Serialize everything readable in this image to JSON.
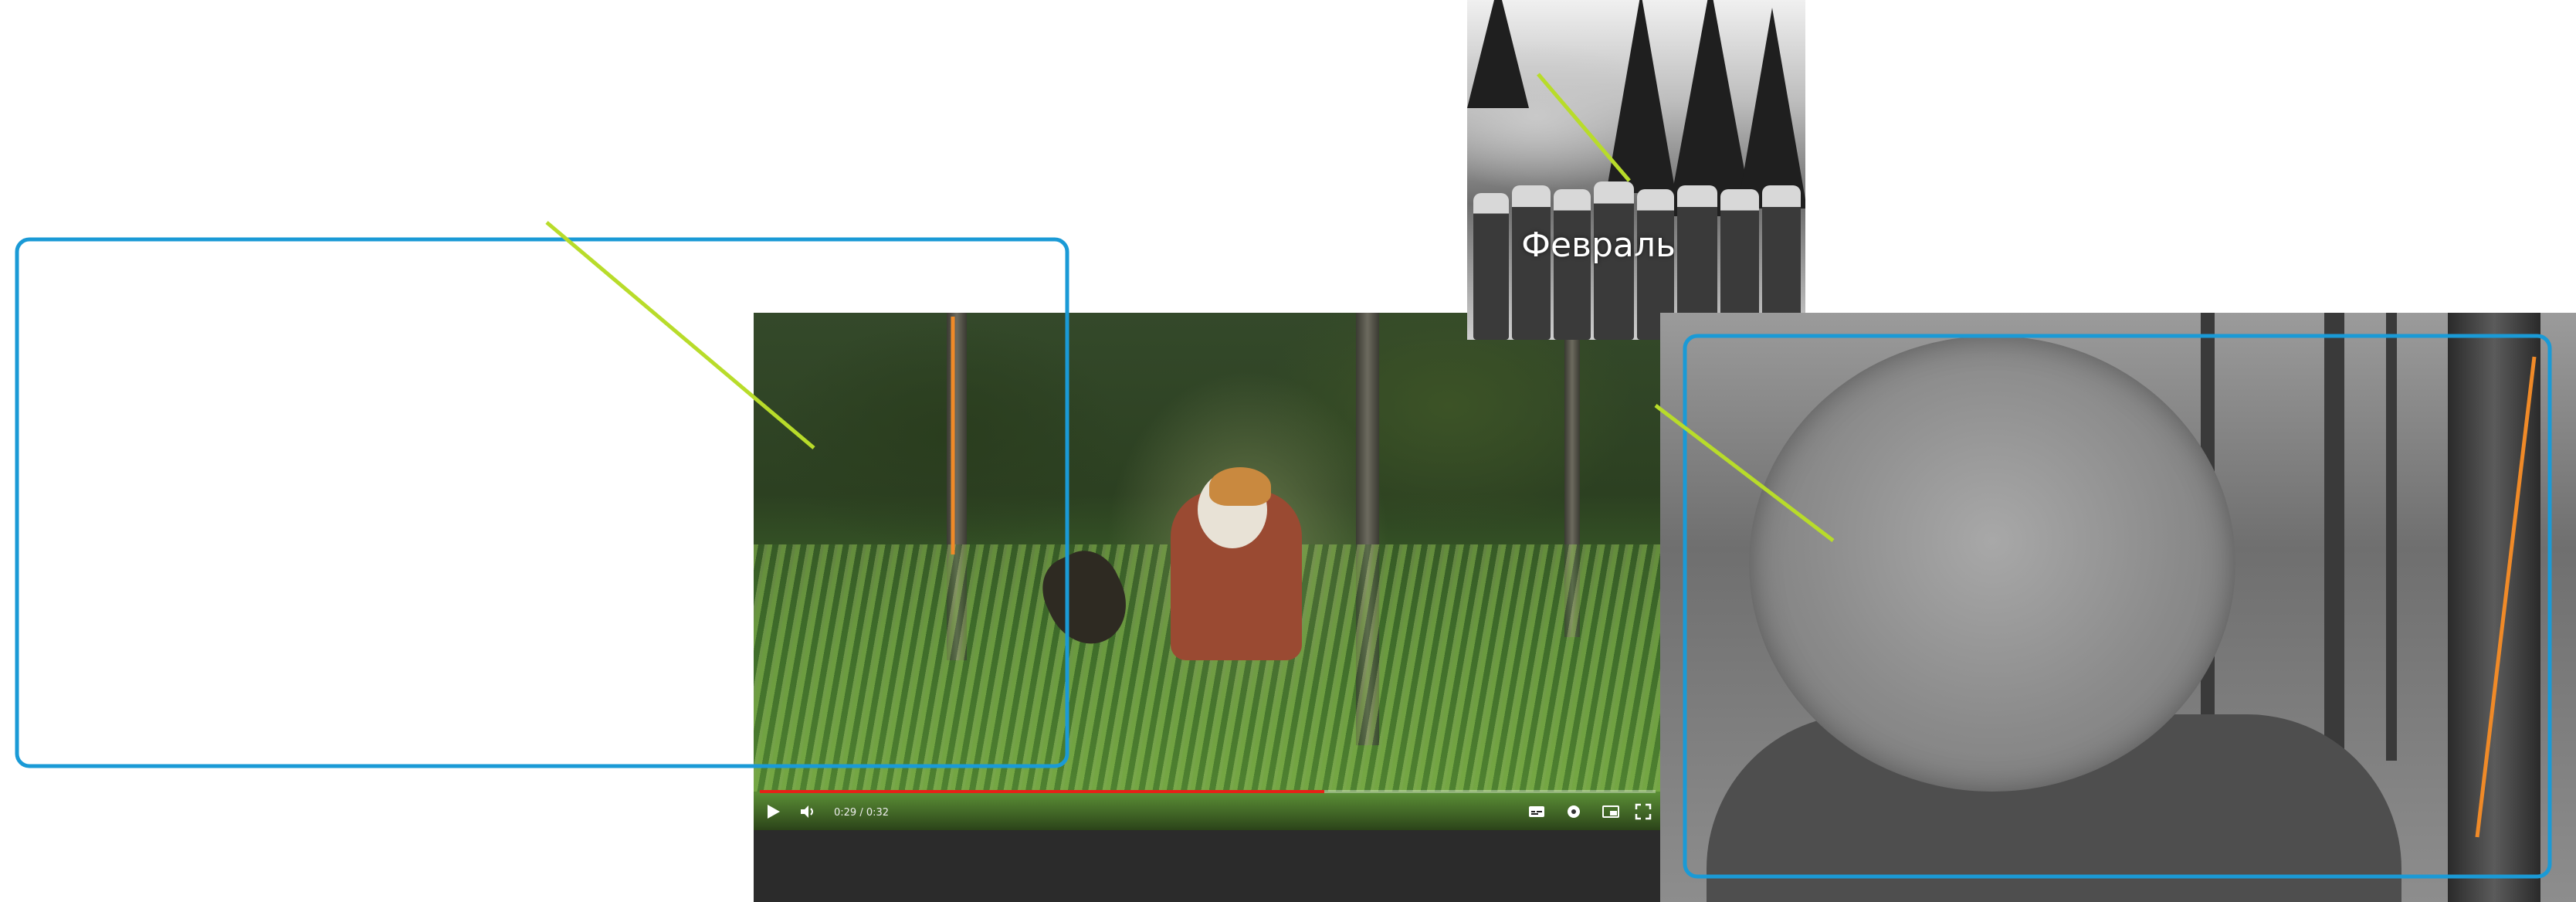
{
  "video": {
    "current_time": "0:29",
    "duration": "0:32",
    "time_text": "0:29 / 0:32",
    "progress_fraction": 0.63,
    "progress_color": "#e62117",
    "icons": [
      "play-icon",
      "volume-icon",
      "subtitles-icon",
      "settings-icon",
      "miniplayer-icon",
      "fullscreen-icon"
    ]
  },
  "photo_february": {
    "caption": "Февраль"
  },
  "annotations": {
    "callout_box_color": "#1a9ad6",
    "leader_line_color": "#b8dc2a",
    "marker_line_color": "#f08a28"
  }
}
